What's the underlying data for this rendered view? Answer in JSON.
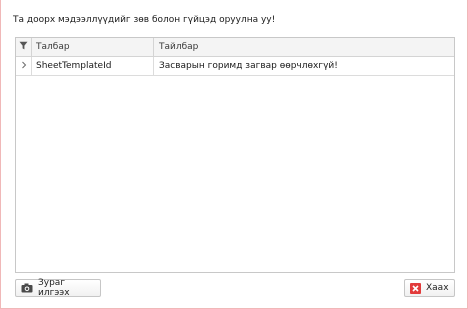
{
  "message": "Та доорх мэдээллүүдийг зөв болон гүйцэд оруулна уу!",
  "grid": {
    "filter_icon": "filter-icon",
    "columns": [
      "Талбар",
      "Тайлбар"
    ],
    "rows": [
      {
        "field": "SheetTemplateId",
        "description": "Засварын горимд загвар өөрчлөхгүй!"
      }
    ]
  },
  "buttons": {
    "screenshot_label": "Зураг илгээх",
    "screenshot_icon": "camera-icon",
    "close_label": "Хаах",
    "close_icon": "close-icon"
  },
  "colors": {
    "close_icon_bg": "#e23b3b",
    "border_accent": "#f0b8b8"
  }
}
